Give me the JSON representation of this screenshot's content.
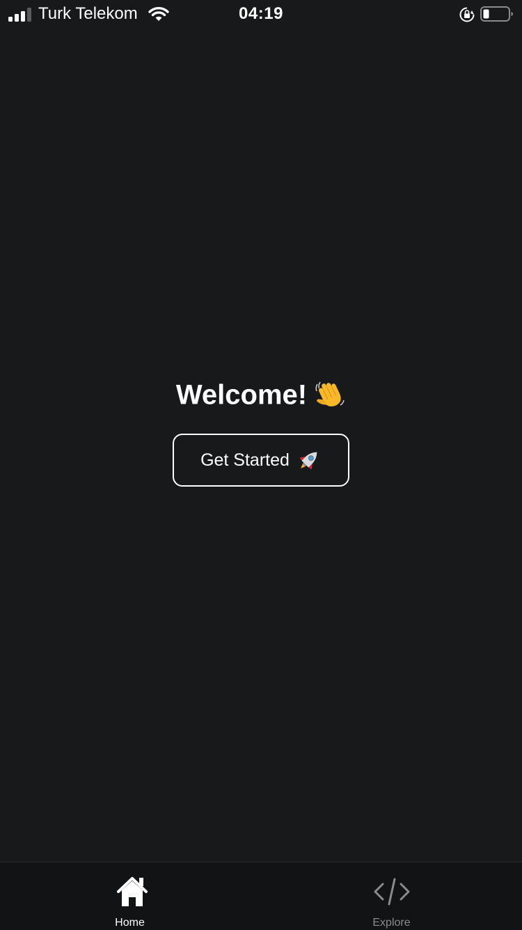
{
  "status_bar": {
    "carrier": "Turk Telekom",
    "time": "04:19",
    "icons": [
      "signal-icon",
      "wifi-icon",
      "orientation-lock-icon",
      "battery-icon"
    ]
  },
  "main": {
    "title": "Welcome!",
    "title_emoji": "waving-hand",
    "button_label": "Get Started",
    "button_emoji": "rocket"
  },
  "tab_bar": {
    "tabs": [
      {
        "label": "Home",
        "icon": "home-icon",
        "active": true
      },
      {
        "label": "Explore",
        "icon": "code-icon",
        "active": false
      }
    ]
  },
  "colors": {
    "background": "#18191b",
    "tab_bar_background": "#121314",
    "text": "#ffffff",
    "inactive_tab": "#8a8b8d"
  }
}
